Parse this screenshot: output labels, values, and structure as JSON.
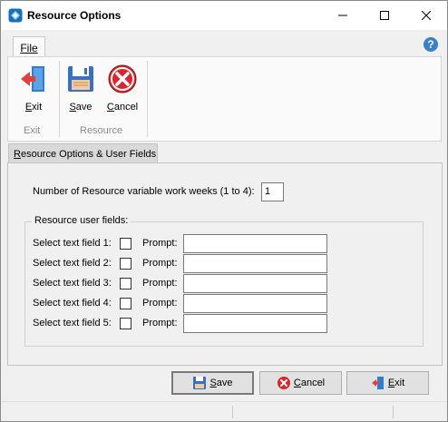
{
  "window": {
    "title": "Resource Options"
  },
  "ribbon": {
    "file_tab": "File",
    "help": "?",
    "buttons": {
      "exit_first": "E",
      "exit_rest": "xit",
      "save_first": "S",
      "save_rest": "ave",
      "cancel_first": "C",
      "cancel_rest": "ancel"
    },
    "groups": {
      "exit": "Exit",
      "resource": "Resource"
    }
  },
  "content": {
    "tab_first": "R",
    "tab_rest": "esource Options & User Fields",
    "weeks_label": "Number of Resource variable work weeks (1 to 4):",
    "weeks_value": "1",
    "user_fields_legend": "Resource user fields:",
    "fields": [
      {
        "label": "Select text field 1:",
        "prompt": "Prompt:",
        "checked": false,
        "value": ""
      },
      {
        "label": "Select text field 2:",
        "prompt": "Prompt:",
        "checked": false,
        "value": ""
      },
      {
        "label": "Select text field 3:",
        "prompt": "Prompt:",
        "checked": false,
        "value": ""
      },
      {
        "label": "Select text field 4:",
        "prompt": "Prompt:",
        "checked": false,
        "value": ""
      },
      {
        "label": "Select text field 5:",
        "prompt": "Prompt:",
        "checked": false,
        "value": ""
      }
    ]
  },
  "footer": {
    "save_first": "S",
    "save_rest": "ave",
    "cancel_first": "C",
    "cancel_rest": "ancel",
    "exit_first": "E",
    "exit_rest": "xit"
  },
  "colors": {
    "accent": "#3a7fc9",
    "cancel_red": "#d9252b",
    "save_blue": "#3b6fc2"
  },
  "icons": [
    "app-icon",
    "minimize-icon",
    "maximize-icon",
    "close-icon",
    "help-icon",
    "exit-door-icon",
    "save-disk-icon",
    "cancel-x-icon"
  ]
}
